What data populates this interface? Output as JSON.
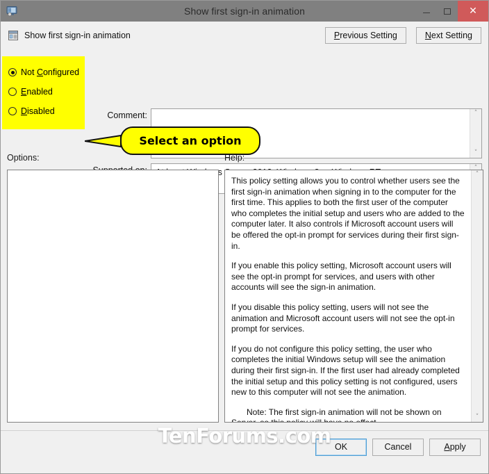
{
  "window": {
    "title": "Show first sign-in animation",
    "icon": "policy-monitor-icon",
    "controls": {
      "minimize": "–",
      "maximize": "□",
      "close": "✕"
    }
  },
  "header": {
    "icon": "policy-setting-icon",
    "title": "Show first sign-in animation",
    "previous_setting": "Previous Setting",
    "previous_setting_accel": "P",
    "next_setting": "Next Setting",
    "next_setting_accel": "N"
  },
  "state_options": {
    "items": [
      {
        "label": "Not Configured",
        "accel": "C",
        "prefix": "Not ",
        "suffix": "onfigured",
        "selected": true
      },
      {
        "label": "Enabled",
        "accel": "E",
        "prefix": "",
        "suffix": "nabled",
        "selected": false
      },
      {
        "label": "Disabled",
        "accel": "D",
        "prefix": "",
        "suffix": "isabled",
        "selected": false
      }
    ],
    "highlight_color": "#ffff00"
  },
  "callout": {
    "text": "Select an option",
    "background": "#ffff00",
    "border_color": "#111111"
  },
  "fields": {
    "comment_label": "Comment:",
    "comment_value": "",
    "supported_label": "Supported on:",
    "supported_value": "At least Windows Server 2012, Windows 8 or Windows RT"
  },
  "panes": {
    "options_label": "Options:",
    "options_content": "",
    "help_label": "Help:",
    "help_paragraphs": [
      "This policy setting allows you to control whether users see the first sign-in animation when signing in to the computer for the first time.  This applies to both the first user of the computer who completes the initial setup and users who are added to the computer later.  It also controls if Microsoft account users will be offered the opt-in prompt for services during their first sign-in.",
      "If you enable this policy setting, Microsoft account users will see the opt-in prompt for services, and users with other accounts will see the sign-in animation.",
      "If you disable this policy setting, users will not see the animation and Microsoft account users will not see the opt-in prompt for services.",
      "If you do not configure this policy setting, the user who completes the initial Windows setup will see the animation during their first sign-in. If the first user had already completed the initial setup and this policy setting is not configured, users new to this computer will not see the animation.",
      "Note: The first sign-in animation will not be shown on Server, so this policy will have no effect."
    ]
  },
  "scrollbar": {
    "up_arrow": "˄",
    "down_arrow": "˅"
  },
  "footer": {
    "ok": "OK",
    "cancel": "Cancel",
    "apply": "Apply",
    "apply_accel": "A"
  },
  "watermark": {
    "text": "TenForums.com"
  }
}
